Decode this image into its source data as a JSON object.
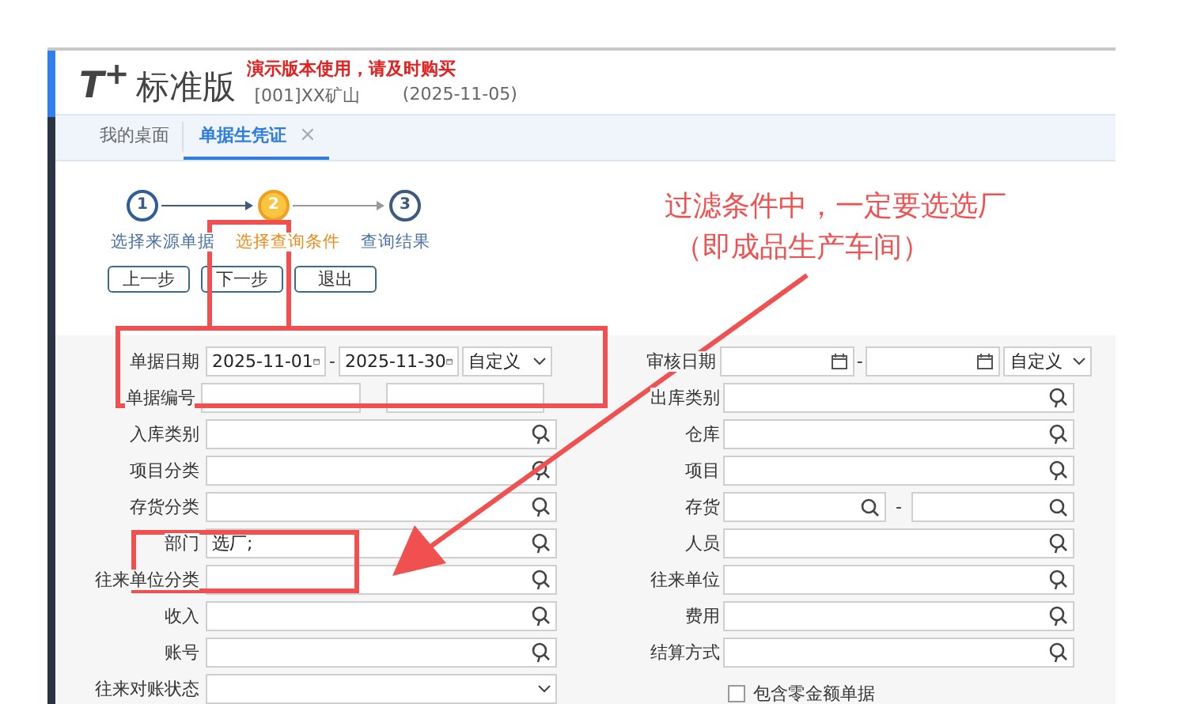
{
  "header": {
    "logo_mark": "T$^{+}$",
    "edition": "标准版",
    "demo_notice": "演示版本使用，请及时购买",
    "account": "[001]XX矿山",
    "date": "(2025-11-05)"
  },
  "tabs": [
    {
      "label": "我的桌面",
      "selected": false
    },
    {
      "label": "单据生凭证",
      "selected": true,
      "close": "×"
    }
  ],
  "steps": [
    {
      "number": "1",
      "label": "选择来源单据",
      "done": true,
      "selected": false
    },
    {
      "number": "2",
      "label": "选择查询条件",
      "done": false,
      "selected": true
    },
    {
      "number": "3",
      "label": "查询结果",
      "done": false,
      "selected": false
    }
  ],
  "buttons": [
    "上一步",
    "下一步",
    "退出"
  ],
  "form_left": [
    {
      "kind": "date_range",
      "label": "单据日期",
      "from": "2025-11-01",
      "separator": "-",
      "to": "2025-11-30",
      "range": "自定义"
    },
    {
      "kind": "text_range",
      "label": "单据编号"
    },
    {
      "kind": "lookup",
      "label": "入库类别"
    },
    {
      "kind": "lookup",
      "label": "项目分类"
    },
    {
      "kind": "lookup",
      "label": "存货分类"
    },
    {
      "kind": "lookup",
      "label": "部门",
      "value": "选厂;"
    },
    {
      "kind": "lookup",
      "label": "往来单位分类"
    },
    {
      "kind": "lookup",
      "label": "收入"
    },
    {
      "kind": "lookup",
      "label": "账号"
    },
    {
      "kind": "select",
      "label": "往来对账状态"
    }
  ],
  "form_right": [
    {
      "kind": "date_range",
      "label": "审核日期",
      "separator": "-",
      "range": "自定义"
    },
    {
      "kind": "lookup",
      "label": "出库类别"
    },
    {
      "kind": "lookup",
      "label": "仓库"
    },
    {
      "kind": "lookup",
      "label": "项目"
    },
    {
      "kind": "search_range",
      "label": "存货",
      "separator": "-"
    },
    {
      "kind": "lookup",
      "label": "人员"
    },
    {
      "kind": "lookup",
      "label": "往来单位"
    },
    {
      "kind": "lookup",
      "label": "费用"
    },
    {
      "kind": "lookup",
      "label": "结算方式"
    },
    {
      "kind": "checkbox",
      "label": "包含零金额单据",
      "checked": false
    }
  ],
  "annotation": {
    "lines": [
      "过滤条件中，一定要选选厂",
      "（即成品生产车间）"
    ]
  }
}
